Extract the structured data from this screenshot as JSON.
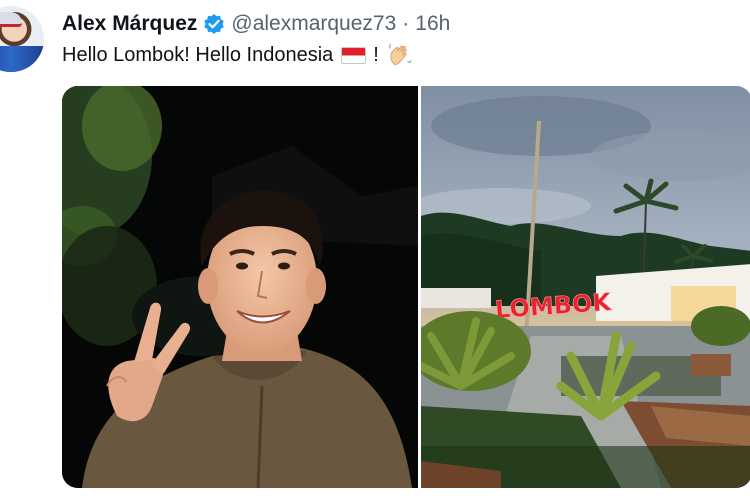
{
  "tweet": {
    "author_name": "Alex Márquez",
    "handle": "@alexmarquez73",
    "separator": "·",
    "time": "16h",
    "text": "Hello Lombok! Hello Indonesia",
    "text_suffix": "!",
    "emoji": [
      "flag-indonesia-icon",
      "waving-hand-icon"
    ],
    "verified": true
  },
  "media": {
    "photos": [
      "selfie-photo",
      "lombok-sign-photo"
    ],
    "sign_text": "LOMBOK"
  },
  "colors": {
    "text": "#0f1419",
    "secondary_text": "#536471",
    "verified_blue": "#1d9bf0",
    "sign_red": "#e8222e"
  }
}
